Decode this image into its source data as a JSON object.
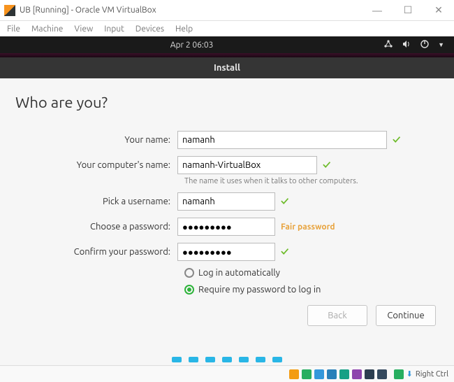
{
  "window": {
    "title": "UB [Running] - Oracle VM VirtualBox",
    "menu": [
      "File",
      "Machine",
      "View",
      "Input",
      "Devices",
      "Help"
    ]
  },
  "ubuntu": {
    "clock": "Apr 2  06:03",
    "install_title": "Install"
  },
  "page": {
    "heading": "Who are you?",
    "labels": {
      "your_name": "Your name:",
      "computer_name": "Your computer's name:",
      "computer_hint": "The name it uses when it talks to other computers.",
      "username": "Pick a username:",
      "password": "Choose a password:",
      "confirm": "Confirm your password:",
      "auto_login": "Log in automatically",
      "require_pw": "Require my password to log in"
    },
    "values": {
      "your_name": "namanh",
      "computer_name": "namanh-VirtualBox",
      "username": "namanh",
      "password": "●●●●●●●●●",
      "confirm": "●●●●●●●●●",
      "strength": "Fair password"
    },
    "buttons": {
      "back": "Back",
      "continue": "Continue"
    }
  },
  "statusbar": {
    "host_key": "Right Ctrl"
  }
}
